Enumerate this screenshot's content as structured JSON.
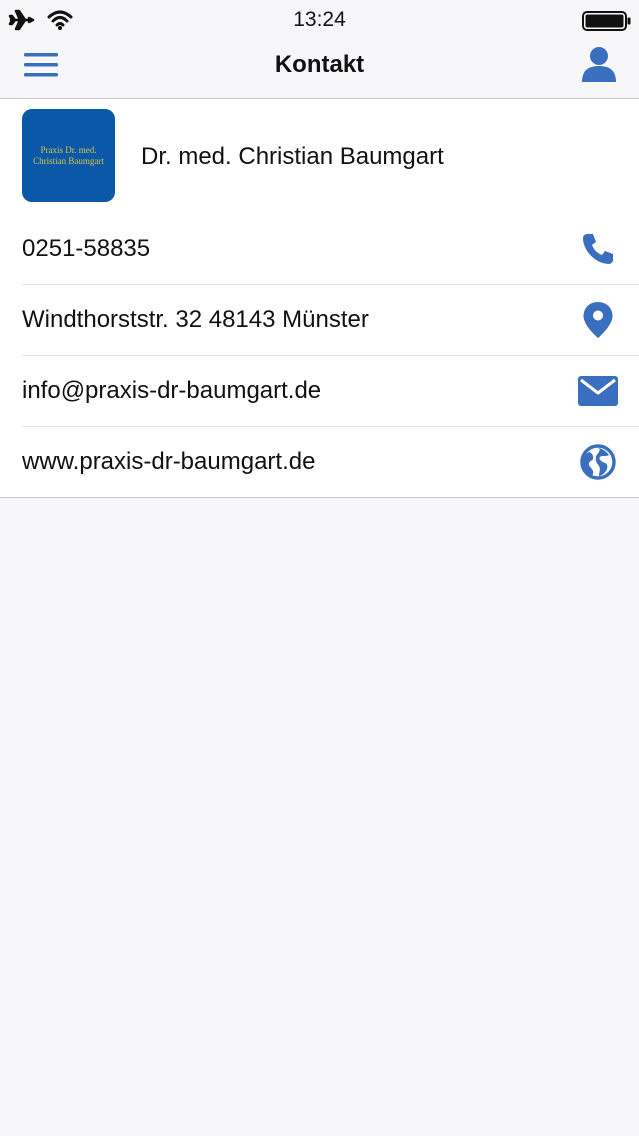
{
  "status_bar": {
    "time": "13:24",
    "icons": [
      "airplane-icon",
      "wifi-icon",
      "battery-icon"
    ]
  },
  "nav": {
    "title": "Kontakt",
    "left_icon": "hamburger-menu-icon",
    "right_icon": "user-profile-icon"
  },
  "contact": {
    "logo_lines": [
      "Praxis Dr. med.",
      "Christian Baumgart"
    ],
    "name": "Dr. med. Christian Baumgart",
    "rows": [
      {
        "text": "0251-58835",
        "icon": "phone-icon"
      },
      {
        "text": "Windthorststr. 32 48143 Münster",
        "icon": "map-pin-icon"
      },
      {
        "text": "info@praxis-dr-baumgart.de",
        "icon": "envelope-icon"
      },
      {
        "text": "www.praxis-dr-baumgart.de",
        "icon": "globe-icon"
      }
    ]
  },
  "colors": {
    "accent": "#3a6fc0",
    "logo_background": "#0b57a8",
    "logo_text": "#d7c640",
    "background": "#f7f7f9"
  }
}
